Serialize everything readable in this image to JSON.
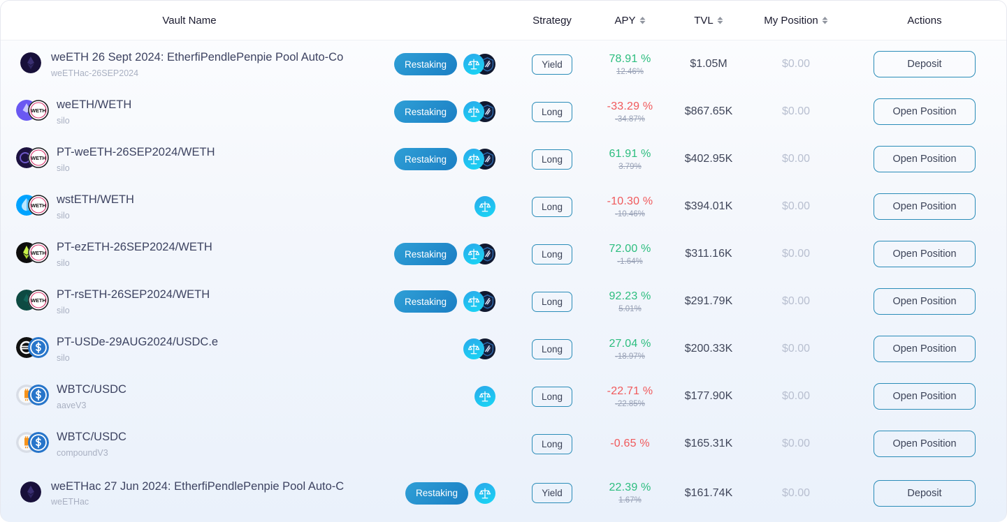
{
  "table": {
    "columns": [
      {
        "key": "vault_name",
        "label": "Vault Name",
        "sortable": false
      },
      {
        "key": "badges",
        "label": "",
        "sortable": false
      },
      {
        "key": "strategy",
        "label": "Strategy",
        "sortable": false
      },
      {
        "key": "apy",
        "label": "APY",
        "sortable": true
      },
      {
        "key": "tvl",
        "label": "TVL",
        "sortable": true
      },
      {
        "key": "my_position",
        "label": "My Position",
        "sortable": true
      },
      {
        "key": "actions",
        "label": "Actions",
        "sortable": false
      }
    ],
    "rows": [
      {
        "name": "weETH 26 Sept 2024: EtherfiPendlePenpie Pool Auto-Co",
        "sub": "weETHac-26SEP2024",
        "tokens": [
          "weeth-dark",
          null
        ],
        "restaking": "Restaking",
        "protocols": [
          "scales-icon",
          "shield-icon"
        ],
        "strategy": "Yield",
        "apy": "78.91 %",
        "apy_dir": "pos",
        "apy_old": "12.46%",
        "tvl": "$1.05M",
        "position": "$0.00",
        "action": "Deposit"
      },
      {
        "name": "weETH/WETH",
        "sub": "silo",
        "tokens": [
          "weeth-purple",
          "weth"
        ],
        "restaking": "Restaking",
        "protocols": [
          "scales-icon",
          "shield-icon"
        ],
        "strategy": "Long",
        "apy": "-33.29 %",
        "apy_dir": "neg",
        "apy_old": "-34.87%",
        "tvl": "$867.65K",
        "position": "$0.00",
        "action": "Open Position"
      },
      {
        "name": "PT-weETH-26SEP2024/WETH",
        "sub": "silo",
        "tokens": [
          "pt-weeth",
          "weth"
        ],
        "restaking": "Restaking",
        "protocols": [
          "scales-icon",
          "shield-icon"
        ],
        "strategy": "Long",
        "apy": "61.91 %",
        "apy_dir": "pos",
        "apy_old": "3.79%",
        "tvl": "$402.95K",
        "position": "$0.00",
        "action": "Open Position"
      },
      {
        "name": "wstETH/WETH",
        "sub": "silo",
        "tokens": [
          "wsteth",
          "weth"
        ],
        "restaking": null,
        "protocols": [
          "scales-icon"
        ],
        "strategy": "Long",
        "apy": "-10.30 %",
        "apy_dir": "neg",
        "apy_old": "-10.46%",
        "tvl": "$394.01K",
        "position": "$0.00",
        "action": "Open Position"
      },
      {
        "name": "PT-ezETH-26SEP2024/WETH",
        "sub": "silo",
        "tokens": [
          "ezeth",
          "weth"
        ],
        "restaking": "Restaking",
        "protocols": [
          "scales-icon",
          "shield-icon"
        ],
        "strategy": "Long",
        "apy": "72.00 %",
        "apy_dir": "pos",
        "apy_old": "-1.64%",
        "tvl": "$311.16K",
        "position": "$0.00",
        "action": "Open Position"
      },
      {
        "name": "PT-rsETH-26SEP2024/WETH",
        "sub": "silo",
        "tokens": [
          "rseth",
          "weth"
        ],
        "restaking": "Restaking",
        "protocols": [
          "scales-icon",
          "shield-icon"
        ],
        "strategy": "Long",
        "apy": "92.23 %",
        "apy_dir": "pos",
        "apy_old": "5.01%",
        "tvl": "$291.79K",
        "position": "$0.00",
        "action": "Open Position"
      },
      {
        "name": "PT-USDe-29AUG2024/USDC.e",
        "sub": "silo",
        "tokens": [
          "usde",
          "usdc"
        ],
        "restaking": null,
        "protocols": [
          "scales-icon",
          "shield-icon"
        ],
        "strategy": "Long",
        "apy": "27.04 %",
        "apy_dir": "pos",
        "apy_old": "-18.97%",
        "tvl": "$200.33K",
        "position": "$0.00",
        "action": "Open Position"
      },
      {
        "name": "WBTC/USDC",
        "sub": "aaveV3",
        "tokens": [
          "wbtc",
          "usdc"
        ],
        "restaking": null,
        "protocols": [
          "scales-icon"
        ],
        "strategy": "Long",
        "apy": "-22.71 %",
        "apy_dir": "neg",
        "apy_old": "-22.85%",
        "tvl": "$177.90K",
        "position": "$0.00",
        "action": "Open Position"
      },
      {
        "name": "WBTC/USDC",
        "sub": "compoundV3",
        "tokens": [
          "wbtc",
          "usdc"
        ],
        "restaking": null,
        "protocols": [],
        "strategy": "Long",
        "apy": "-0.65 %",
        "apy_dir": "neg",
        "apy_old": null,
        "tvl": "$165.31K",
        "position": "$0.00",
        "action": "Open Position"
      },
      {
        "name": "weETHac 27 Jun 2024: EtherfiPendlePenpie Pool Auto-C",
        "sub": "weETHac",
        "tokens": [
          "weeth-dark",
          null
        ],
        "restaking": "Restaking",
        "protocols": [
          "scales-icon"
        ],
        "strategy": "Yield",
        "apy": "22.39 %",
        "apy_dir": "pos",
        "apy_old": "1.67%",
        "tvl": "$161.74K",
        "position": "$0.00",
        "action": "Deposit"
      }
    ]
  },
  "colors": {
    "positive": "#2bbd7e",
    "negative": "#f0595b",
    "accent": "#2a8cb8",
    "restaking_pill": "#1b7fc4",
    "muted": "#a9b0c2"
  }
}
